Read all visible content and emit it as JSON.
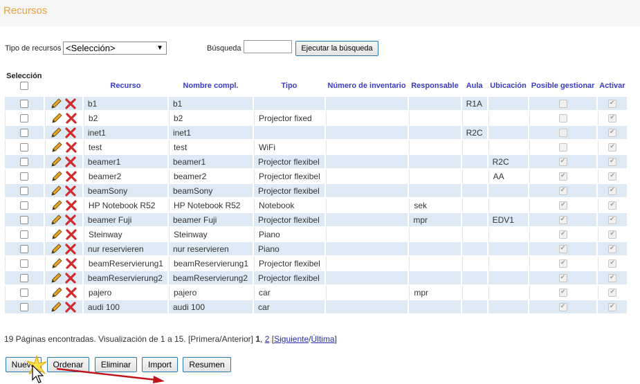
{
  "header": {
    "title": "Recursos"
  },
  "filter": {
    "type_label": "Tipo de recursos",
    "type_value": "<Selección>",
    "search_label": "Búsqueda",
    "search_value": "",
    "search_button": "Ejecutar la búsqueda"
  },
  "table": {
    "headers": {
      "selection": "Selección",
      "resource": "Recurso",
      "fullname": "Nombre compl.",
      "type": "Tipo",
      "inventory": "Número de inventario",
      "responsible": "Responsable",
      "room": "Aula",
      "location": "Ubicación",
      "manageable": "Posible gestionar",
      "active": "Activar"
    },
    "rows": [
      {
        "resource": "b1",
        "fullname": "b1",
        "type": "",
        "inventory": "",
        "responsible": "",
        "room": "R1A",
        "location": "",
        "manageable": false,
        "active": true
      },
      {
        "resource": "b2",
        "fullname": "b2",
        "type": "Projector fixed",
        "inventory": "",
        "responsible": "",
        "room": "",
        "location": "",
        "manageable": false,
        "active": true
      },
      {
        "resource": "inet1",
        "fullname": "inet1",
        "type": "",
        "inventory": "",
        "responsible": "",
        "room": "R2C",
        "location": "",
        "manageable": false,
        "active": true
      },
      {
        "resource": "test",
        "fullname": "test",
        "type": "WiFi",
        "inventory": "",
        "responsible": "",
        "room": "",
        "location": "",
        "manageable": false,
        "active": true
      },
      {
        "resource": "beamer1",
        "fullname": "beamer1",
        "type": "Projector flexibel",
        "inventory": "",
        "responsible": "",
        "room": "",
        "location": "R2C",
        "manageable": true,
        "active": true
      },
      {
        "resource": "beamer2",
        "fullname": "beamer2",
        "type": "Projector flexibel",
        "inventory": "",
        "responsible": "",
        "room": "",
        "location": "AA",
        "manageable": true,
        "active": true
      },
      {
        "resource": "beamSony",
        "fullname": "beamSony",
        "type": "Projector flexibel",
        "inventory": "",
        "responsible": "",
        "room": "",
        "location": "",
        "manageable": true,
        "active": true
      },
      {
        "resource": "HP Notebook R52",
        "fullname": "HP Notebook R52",
        "type": "Notebook",
        "inventory": "",
        "responsible": "sek",
        "room": "",
        "location": "",
        "manageable": true,
        "active": true
      },
      {
        "resource": "beamer Fuji",
        "fullname": "beamer Fuji",
        "type": "Projector flexibel",
        "inventory": "",
        "responsible": "mpr",
        "room": "",
        "location": "EDV1",
        "manageable": true,
        "active": true
      },
      {
        "resource": "Steinway",
        "fullname": "Steinway",
        "type": "Piano",
        "inventory": "",
        "responsible": "",
        "room": "",
        "location": "",
        "manageable": true,
        "active": true
      },
      {
        "resource": "nur reservieren",
        "fullname": "nur reservieren",
        "type": "Piano",
        "inventory": "",
        "responsible": "",
        "room": "",
        "location": "",
        "manageable": true,
        "active": true
      },
      {
        "resource": "beamReservierung1",
        "fullname": "beamReservierung1",
        "type": "Projector flexibel",
        "inventory": "",
        "responsible": "",
        "room": "",
        "location": "",
        "manageable": true,
        "active": true
      },
      {
        "resource": "beamReservierung2",
        "fullname": "beamReservierung2",
        "type": "Projector flexibel",
        "inventory": "",
        "responsible": "",
        "room": "",
        "location": "",
        "manageable": true,
        "active": true
      },
      {
        "resource": "pajero",
        "fullname": "pajero",
        "type": "car",
        "inventory": "",
        "responsible": "mpr",
        "room": "",
        "location": "",
        "manageable": true,
        "active": true
      },
      {
        "resource": "audi 100",
        "fullname": "audi 100",
        "type": "car",
        "inventory": "",
        "responsible": "",
        "room": "",
        "location": "",
        "manageable": true,
        "active": true
      }
    ]
  },
  "pager": {
    "summary": "19 Páginas encontradas. Visualización de 1 a 15. [Primera/Anterior]",
    "page1": "1",
    "sep": ",",
    "page2": "2",
    "open": "[",
    "next": "Siguiente",
    "slash": "/",
    "last": "Última",
    "close": "]"
  },
  "actions": {
    "new": "Nuevo",
    "order": "Ordenar",
    "delete": "Eliminar",
    "import": "Import",
    "summary": "Resumen"
  },
  "colors": {
    "title": "#e8a33d",
    "header_text": "#3a3acd",
    "row_alt": "#dde9f5",
    "arrow": "#c0141b"
  },
  "icons": {
    "edit": "pencil-icon",
    "delete": "red-x-icon"
  }
}
